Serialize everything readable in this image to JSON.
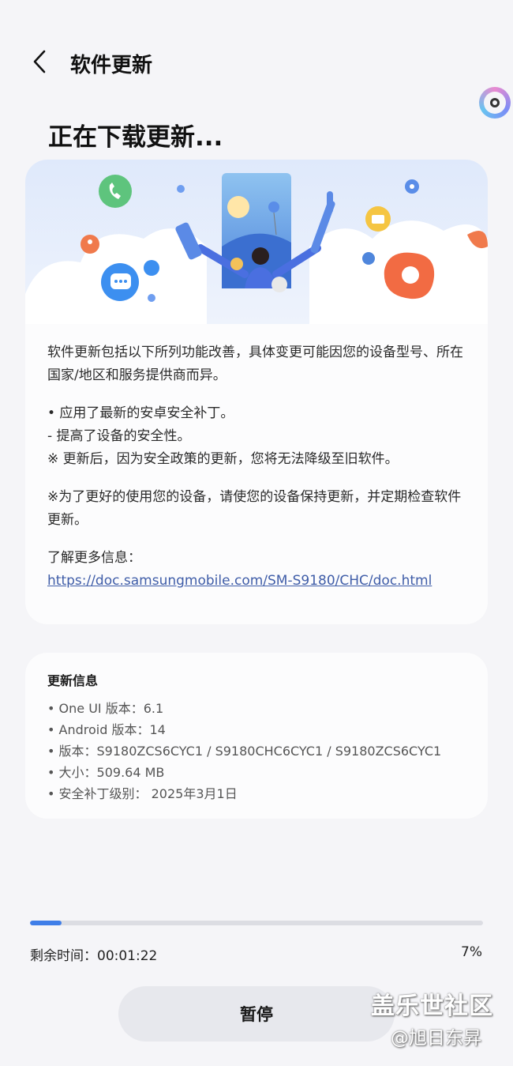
{
  "header": {
    "title": "软件更新"
  },
  "page_title": "正在下载更新...",
  "description": {
    "intro": "软件更新包括以下所列功能改善，具体变更可能因您的设备型号、所在国家/地区和服务提供商而异。",
    "bullet_1": "• 应用了最新的安卓安全补丁。",
    "bullet_1_sub": " - 提高了设备的安全性。",
    "note": "※ 更新后，因为安全政策的更新，您将无法降级至旧软件。",
    "advice": "※为了更好的使用您的设备，请使您的设备保持更新，并定期检查软件更新。",
    "more_info_label": "了解更多信息：",
    "more_info_link": "https://doc.samsungmobile.com/SM-S9180/CHC/doc.html"
  },
  "update_info": {
    "title": "更新信息",
    "items": [
      "• One UI 版本：6.1",
      "• Android 版本：14",
      "• 版本：S9180ZCS6CYC1 / S9180CHC6CYC1 / S9180ZCS6CYC1",
      "• 大小：509.64 MB",
      "• 安全补丁级别： 2025年3月1日"
    ]
  },
  "progress": {
    "value_percent": 7,
    "remaining_label": "剩余时间：00:01:22",
    "percent_label": "7%"
  },
  "pause_button": {
    "label": "暂停"
  },
  "watermark": {
    "line1": "盖乐世社区",
    "line2": "@旭日东昇"
  },
  "colors": {
    "background": "#f5f5f8",
    "card": "#fcfcfd",
    "link": "#3f5da8",
    "progress_fill": "#3f7ee8",
    "progress_track": "#dcdde3",
    "button_bg": "#e7e8ed"
  }
}
